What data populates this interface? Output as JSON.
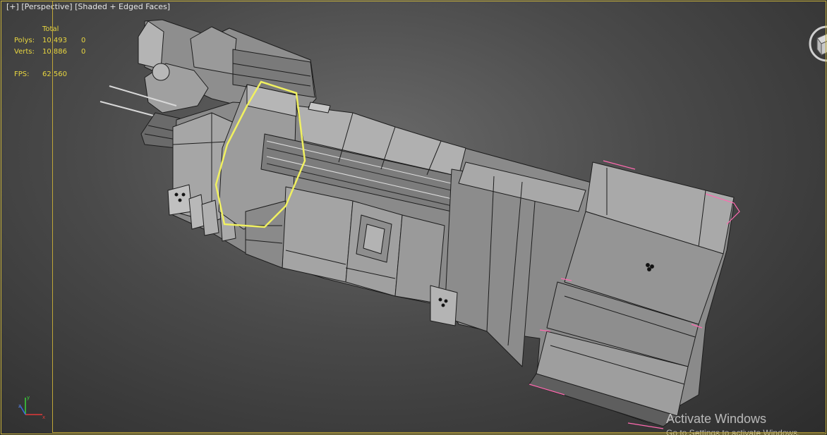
{
  "viewport": {
    "label_parts": [
      "[+]",
      "[Perspective]",
      "[Shaded + Edged Faces]"
    ]
  },
  "stats": {
    "header": "Total",
    "polys_label": "Polys:",
    "polys_total": "10,493",
    "polys_sel": "0",
    "verts_label": "Verts:",
    "verts_total": "10,886",
    "verts_sel": "0",
    "fps_label": "FPS:",
    "fps_value": "62.560"
  },
  "overlay": {
    "title": "Activate Windows",
    "subtitle": "Go to Settings to activate Windows."
  },
  "colors": {
    "viewport_border": "#c8b23a",
    "stats_text": "#e8d640",
    "selection": "#f0f060",
    "soft_selection": "#ff6ab0"
  },
  "icons": [
    "axis-tripod-icon",
    "viewcube-icon"
  ]
}
